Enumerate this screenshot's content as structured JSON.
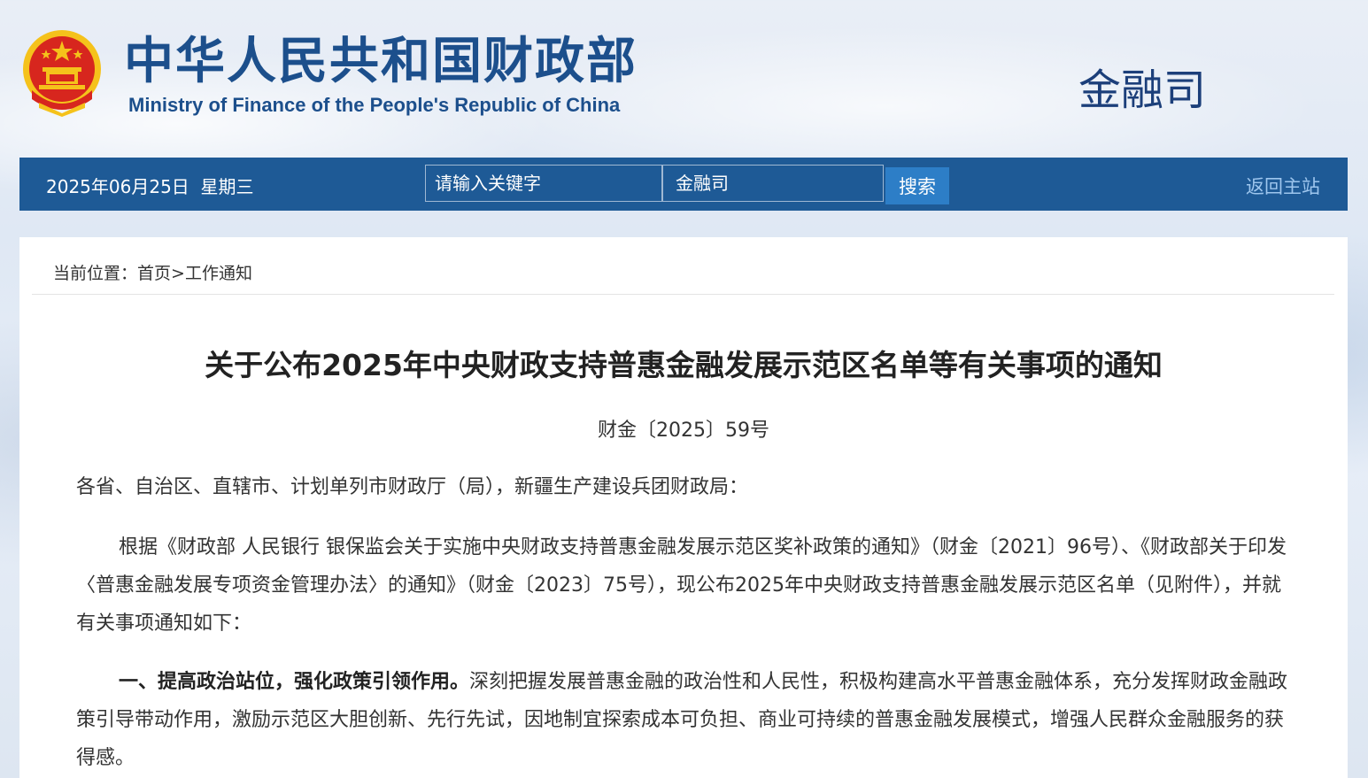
{
  "header": {
    "site_title": "中华人民共和国财政部",
    "site_subtitle": "Ministry of Finance of the People's Republic of China",
    "department": "金融司"
  },
  "navbar": {
    "date": "2025年06月25日  星期三",
    "search_placeholder": "请输入关键字",
    "scope_selected": "金融司",
    "search_button": "搜索",
    "home_link": "返回主站"
  },
  "breadcrumb": {
    "prefix": "当前位置：",
    "home": "首页",
    "separator": ">",
    "current": "工作通知"
  },
  "document": {
    "title": "关于公布2025年中央财政支持普惠金融发展示范区名单等有关事项的通知",
    "number": "财金〔2025〕59号",
    "salutation": "各省、自治区、直辖市、计划单列市财政厅（局），新疆生产建设兵团财政局：",
    "paragraph1": "根据《财政部 人民银行 银保监会关于实施中央财政支持普惠金融发展示范区奖补政策的通知》（财金〔2021〕96号）、《财政部关于印发〈普惠金融发展专项资金管理办法〉的通知》（财金〔2023〕75号），现公布2025年中央财政支持普惠金融发展示范区名单（见附件），并就有关事项通知如下：",
    "paragraph2_heading": "一、提高政治站位，强化政策引领作用。",
    "paragraph2_text": "深刻把握发展普惠金融的政治性和人民性，积极构建高水平普惠金融体系，充分发挥财政金融政策引导带动作用，激励示范区大胆创新、先行先试，因地制宜探索成本可负担、商业可持续的普惠金融发展模式，增强人民群众金融服务的获得感。"
  },
  "colors": {
    "navbar": "#1e5a96",
    "title_blue": "#1c4f8c",
    "search_button": "#2d7ec7",
    "emblem_red": "#d7261e",
    "emblem_gold": "#f5c21b"
  }
}
